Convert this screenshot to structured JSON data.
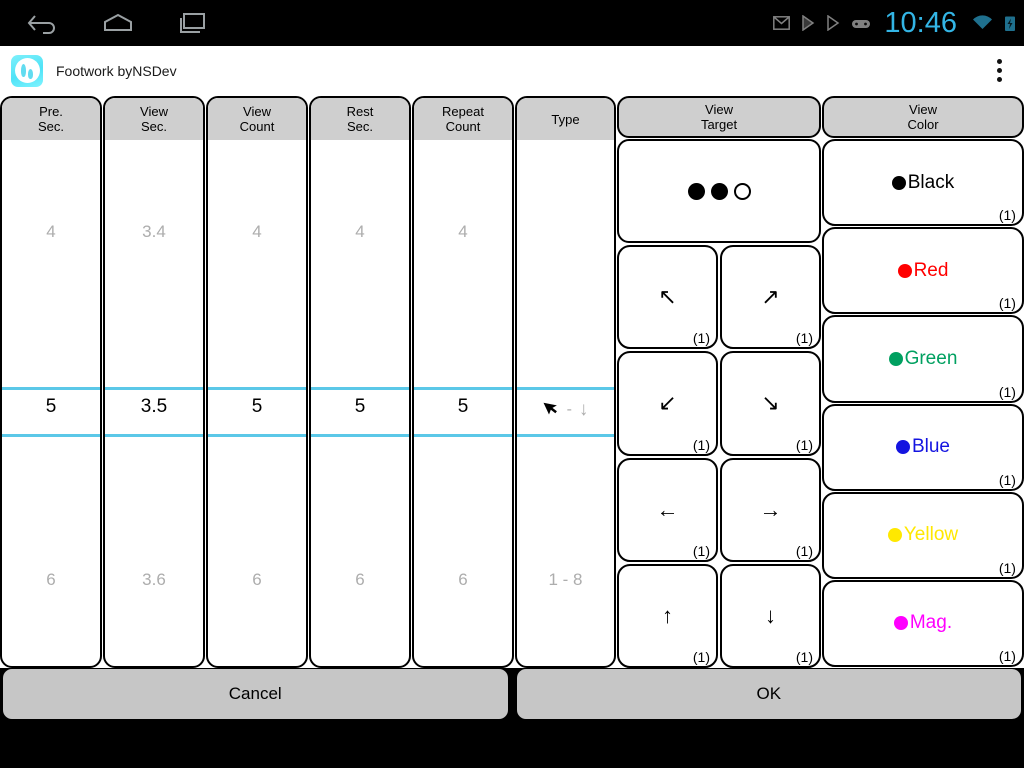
{
  "statusbar": {
    "nav": [
      {
        "name": "back-icon",
        "label": "Back"
      },
      {
        "name": "home-icon",
        "label": "Home"
      },
      {
        "name": "recents-icon",
        "label": "Recent apps"
      }
    ],
    "icons": [
      {
        "name": "gmail-icon",
        "label": "Gmail"
      },
      {
        "name": "play-music-icon",
        "label": "Play Music"
      },
      {
        "name": "play-store-icon",
        "label": "Play Store"
      },
      {
        "name": "game-controller-icon",
        "label": "Game"
      }
    ],
    "time": "10:46",
    "wifi": "wifi-icon",
    "battery": "battery-charging-icon",
    "accent_color": "#33b5e5"
  },
  "actionbar": {
    "title": "Footwork byNSDev",
    "app_icon": "footwork-app-icon",
    "overflow": "overflow-menu-icon"
  },
  "pickers": [
    {
      "key": "pre_sec",
      "header_line1": "Pre.",
      "header_line2": "Sec.",
      "above": "4",
      "selected": "5",
      "below": "6"
    },
    {
      "key": "view_sec",
      "header_line1": "View",
      "header_line2": "Sec.",
      "above": "3.4",
      "selected": "3.5",
      "below": "3.6"
    },
    {
      "key": "view_count",
      "header_line1": "View",
      "header_line2": "Count",
      "above": "4",
      "selected": "5",
      "below": "6"
    },
    {
      "key": "rest_sec",
      "header_line1": "Rest",
      "header_line2": "Sec.",
      "above": "4",
      "selected": "5",
      "below": "6"
    },
    {
      "key": "repeat_count",
      "header_line1": "Repeat",
      "header_line2": "Count",
      "above": "4",
      "selected": "5",
      "below": "6"
    }
  ],
  "type_picker": {
    "key": "type",
    "header_line1": "Type",
    "header_line2": "",
    "above": "",
    "selected_left_icon": "cursor-arrow-icon",
    "selected_dash": "-",
    "selected_right_icon": "arrow-down-icon",
    "below": "1 - 8"
  },
  "target": {
    "header_line1": "View",
    "header_line2": "Target",
    "preview": {
      "name": "target-dots-preview",
      "dots": [
        "filled",
        "filled",
        "hollow"
      ]
    },
    "buttons": [
      {
        "icon": "arrow-up-left-icon",
        "glyph": "↖",
        "count": "(1)"
      },
      {
        "icon": "arrow-up-right-icon",
        "glyph": "↗",
        "count": "(1)"
      },
      {
        "icon": "arrow-down-left-icon",
        "glyph": "↙",
        "count": "(1)"
      },
      {
        "icon": "arrow-down-right-icon",
        "glyph": "↘",
        "count": "(1)"
      },
      {
        "icon": "arrow-left-icon",
        "glyph": "←",
        "count": "(1)"
      },
      {
        "icon": "arrow-right-icon",
        "glyph": "→",
        "count": "(1)"
      },
      {
        "icon": "arrow-up-icon",
        "glyph": "↑",
        "count": "(1)"
      },
      {
        "icon": "arrow-down-icon",
        "glyph": "↓",
        "count": "(1)"
      }
    ]
  },
  "color": {
    "header_line1": "View",
    "header_line2": "Color",
    "items": [
      {
        "label": "Black",
        "hex": "#000000",
        "count": "(1)"
      },
      {
        "label": "Red",
        "hex": "#ff0000",
        "count": "(1)"
      },
      {
        "label": "Green",
        "hex": "#00a060",
        "count": "(1)"
      },
      {
        "label": "Blue",
        "hex": "#1414e0",
        "count": "(1)"
      },
      {
        "label": "Yellow",
        "hex": "#ffe800",
        "count": "(1)"
      },
      {
        "label": "Mag.",
        "hex": "#ff00ff",
        "count": "(1)"
      }
    ]
  },
  "footer": {
    "cancel": "Cancel",
    "ok": "OK"
  },
  "selection_line_color": "#5bc8e8"
}
